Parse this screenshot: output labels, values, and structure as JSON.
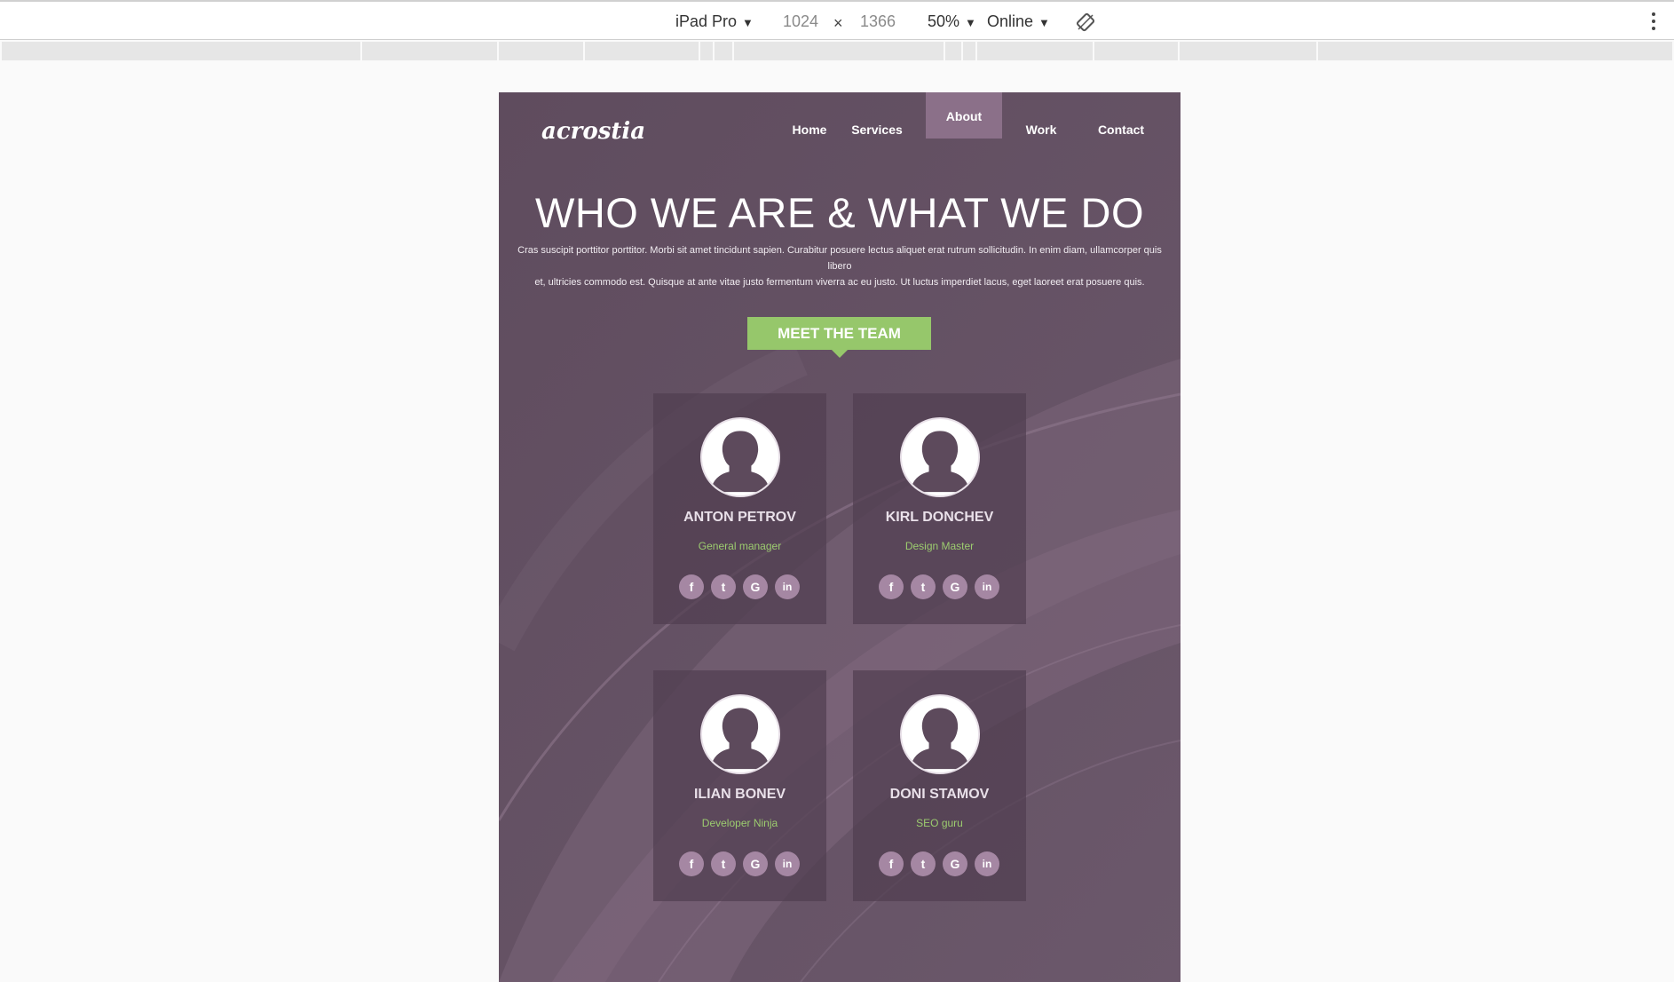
{
  "devtools": {
    "device": "iPad Pro",
    "width": "1024",
    "times": "×",
    "height": "1366",
    "zoom": "50%",
    "network": "Online",
    "icons": {
      "caret": "caret-down-icon",
      "rotate": "rotate-icon",
      "more": "more-vert-icon"
    }
  },
  "site": {
    "logo": "acrostia",
    "nav": [
      {
        "label": "Home",
        "active": false
      },
      {
        "label": "Services",
        "active": false
      },
      {
        "label": "About",
        "active": true
      },
      {
        "label": "Work",
        "active": false
      },
      {
        "label": "Contact",
        "active": false
      }
    ],
    "hero_title": "WHO WE ARE & WHAT WE DO",
    "hero_text_line1": "Cras suscipit porttitor porttitor. Morbi sit amet tincidunt sapien. Curabitur posuere lectus aliquet erat rutrum sollicitudin. In enim diam, ullamcorper quis libero",
    "hero_text_line2": "et, ultricies commodo est. Quisque at ante vitae justo fermentum viverra ac eu justo. Ut luctus imperdiet lacus, eget laoreet erat posuere quis.",
    "meet_label": "MEET THE TEAM",
    "team": [
      {
        "name": "ANTON PETROV",
        "role": "General manager"
      },
      {
        "name": "KIRL DONCHEV",
        "role": "Design Master"
      },
      {
        "name": "ILIAN BONEV",
        "role": "Developer Ninja"
      },
      {
        "name": "DONI STAMOV",
        "role": "SEO guru"
      }
    ],
    "social": {
      "facebook": "f",
      "twitter": "t",
      "google": "G",
      "linkedin": "in"
    },
    "colors": {
      "background": "#665566",
      "accent_green": "#96c76b",
      "nav_active": "#8b7089",
      "social_bg": "#a587a3"
    }
  }
}
